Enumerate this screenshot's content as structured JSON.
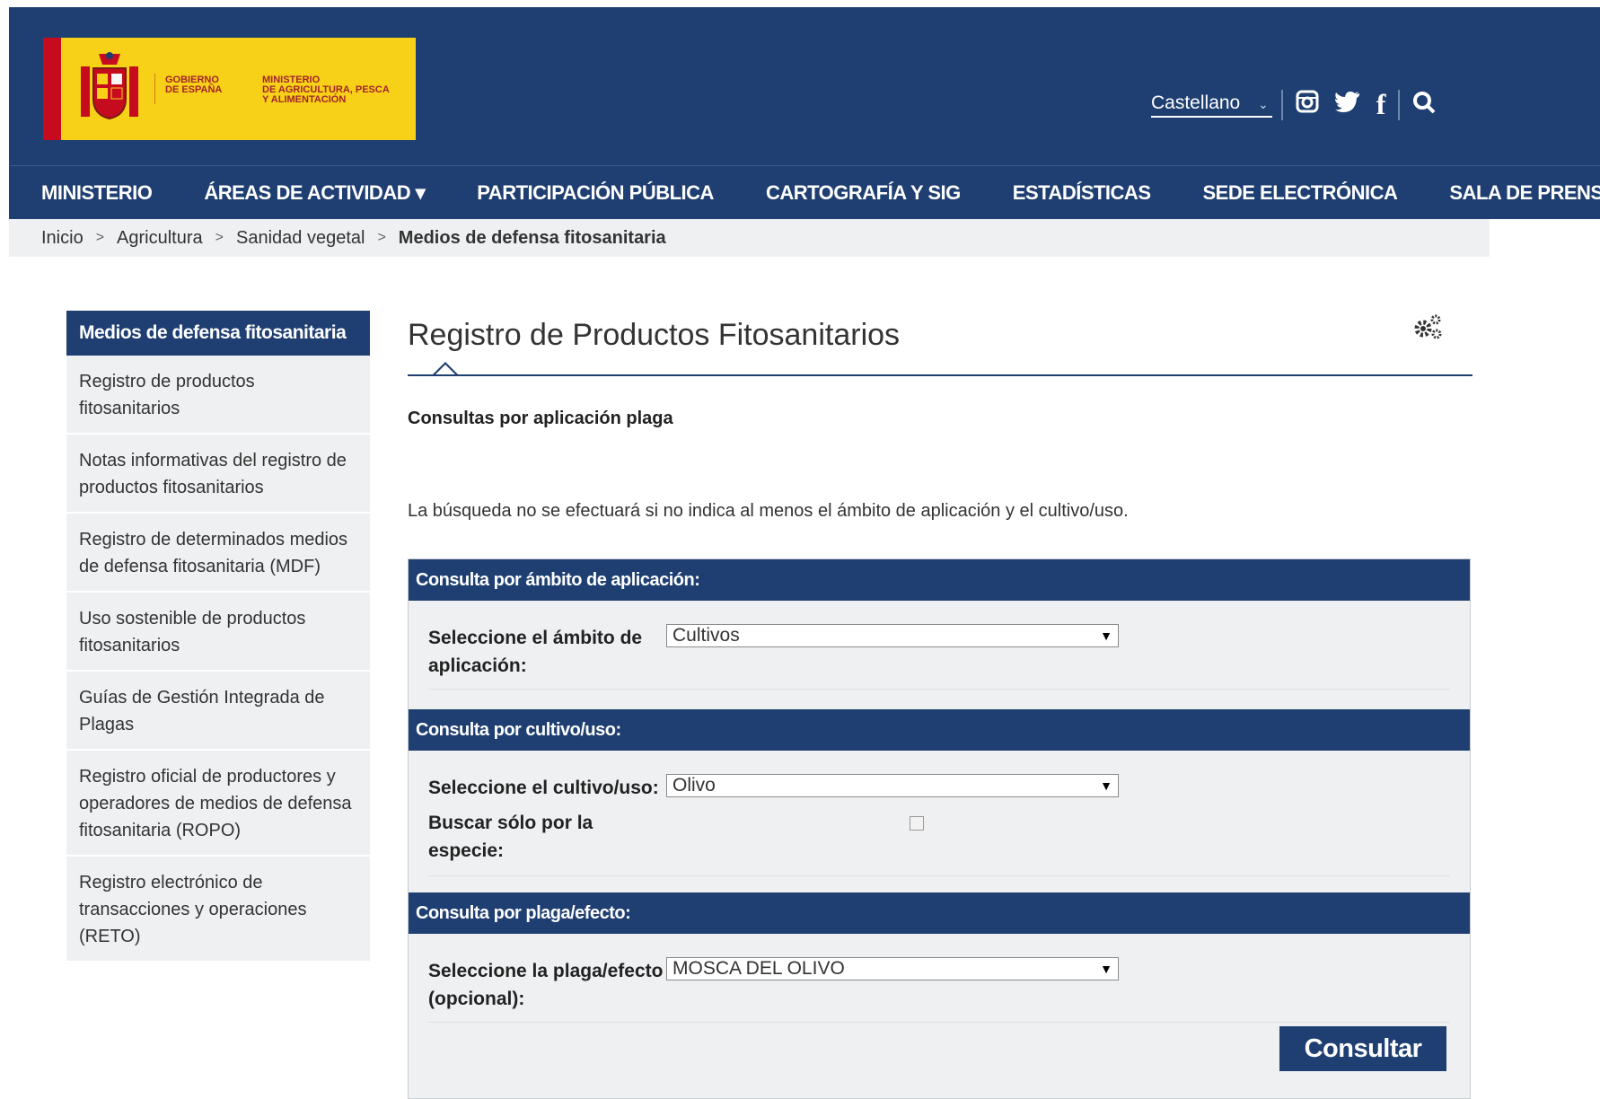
{
  "header": {
    "logo": {
      "gobierno": "GOBIERNO\nDE ESPAÑA",
      "ministerio": "MINISTERIO\nDE AGRICULTURA, PESCA\nY ALIMENTACIÓN"
    },
    "language": "Castellano",
    "social_icons": [
      "instagram-icon",
      "twitter-icon",
      "facebook-icon"
    ],
    "search_icon": "search-icon"
  },
  "nav": {
    "items": [
      {
        "label": "MINISTERIO"
      },
      {
        "label": "ÁREAS DE ACTIVIDAD ▾"
      },
      {
        "label": "PARTICIPACIÓN PÚBLICA"
      },
      {
        "label": "CARTOGRAFÍA Y SIG"
      },
      {
        "label": "ESTADÍSTICAS"
      },
      {
        "label": "SEDE ELECTRÓNICA"
      },
      {
        "label": "SALA DE PRENSA"
      }
    ]
  },
  "breadcrumb": {
    "items": [
      "Inicio",
      "Agricultura",
      "Sanidad vegetal"
    ],
    "current": "Medios de defensa fitosanitaria",
    "separator": ">"
  },
  "sidebar": {
    "title": "Medios de defensa fitosanitaria",
    "items": [
      {
        "label": "Registro de productos fitosanitarios"
      },
      {
        "label": "Notas informativas del registro de productos fitosanitarios"
      },
      {
        "label": "Registro de determinados medios de defensa fitosanitaria (MDF)"
      },
      {
        "label": "Uso sostenible de productos fitosanitarios"
      },
      {
        "label": "Guías de Gestión Integrada de Plagas"
      },
      {
        "label": "Registro oficial de productores y operadores de medios de defensa fitosanitaria (ROPO)"
      },
      {
        "label": "Registro electrónico de transacciones y operaciones (RETO)"
      }
    ]
  },
  "main": {
    "title": "Registro de Productos Fitosanitarios",
    "subtitle": "Consultas por aplicación plaga",
    "note": "La búsqueda no se efectuará si no indica al menos el ámbito de aplicación y el cultivo/uso.",
    "form": {
      "section1": {
        "header": "Consulta por ámbito de aplicación:",
        "label": "Seleccione el ámbito de aplicación:",
        "value": "Cultivos"
      },
      "section2": {
        "header": "Consulta por cultivo/uso:",
        "label": "Seleccione el cultivo/uso:",
        "value": "Olivo",
        "checkbox_label": "Buscar sólo por la especie:",
        "checked": false
      },
      "section3": {
        "header": "Consulta por plaga/efecto:",
        "label": "Seleccione la plaga/efecto (opcional):",
        "value": "MOSCA DEL OLIVO"
      },
      "submit_label": "Consultar"
    }
  },
  "colors": {
    "brand_blue": "#1f3f72",
    "logo_yellow": "#f7d117",
    "panel_gray": "#eef0f2"
  }
}
